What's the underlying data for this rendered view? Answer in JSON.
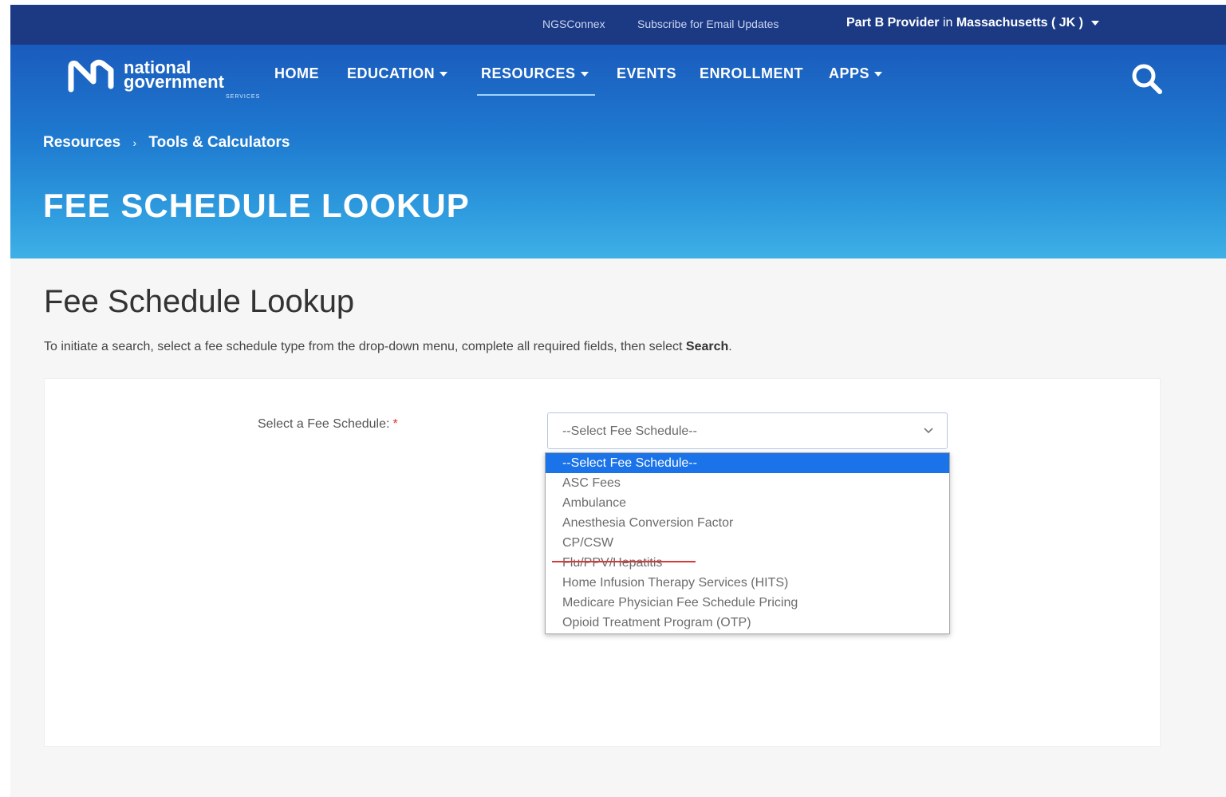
{
  "utility": {
    "links": [
      "NGSConnex",
      "Subscribe for Email Updates"
    ],
    "provider_prefix": "Part B Provider",
    "provider_in": "in",
    "provider_state": "Massachusetts ( JK )"
  },
  "logo": {
    "line1": "national",
    "line2": "government",
    "line3": "SERVICES"
  },
  "nav": {
    "home": "HOME",
    "education": "EDUCATION",
    "resources": "RESOURCES",
    "events": "EVENTS",
    "enrollment": "ENROLLMENT",
    "apps": "APPS"
  },
  "breadcrumb": {
    "items": [
      "Resources",
      "Tools & Calculators"
    ],
    "separator": "›"
  },
  "hero": {
    "title": "FEE SCHEDULE LOOKUP"
  },
  "main": {
    "heading": "Fee Schedule Lookup",
    "instructions": "To initiate a search, select a fee schedule type from the drop-down menu, complete all required fields, then select ",
    "instructions_bold": "Search",
    "instructions_end": "."
  },
  "form": {
    "label": "Select a Fee Schedule:",
    "required_mark": "*",
    "select_value": "--Select Fee Schedule--",
    "options": [
      "--Select Fee Schedule--",
      "ASC Fees",
      "Ambulance",
      "Anesthesia Conversion Factor",
      "CP/CSW",
      "Flu/PPV/Hepatitis",
      "Home Infusion Therapy Services (HITS)",
      "Medicare Physician Fee Schedule Pricing",
      "Opioid Treatment Program (OTP)"
    ],
    "selected_index": 0
  },
  "colors": {
    "utility_bar": "#1c3a84",
    "hero_top": "#1a5bbd",
    "hero_bottom": "#3fb0e6",
    "selected_option": "#1a73e8",
    "required": "#e0342b",
    "strike_annotation": "#d43a3a"
  },
  "icons": {
    "search": "search-icon",
    "caret": "caret-down-icon",
    "chevron": "chevron-down-icon"
  }
}
